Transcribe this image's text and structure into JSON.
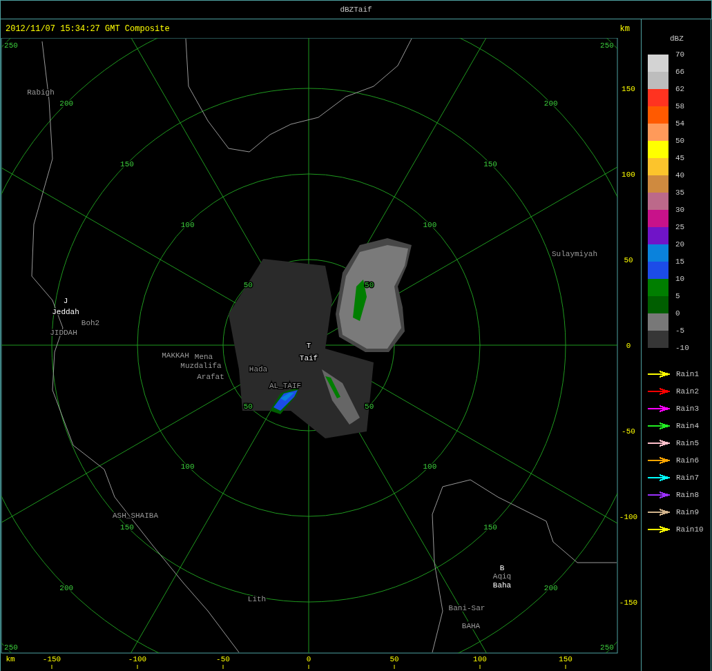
{
  "window": {
    "title": "dBZTaif"
  },
  "header": {
    "timestamp": "2012/11/07 15:34:27 GMT Composite",
    "unit": "km"
  },
  "radar_map": {
    "range_rings": [
      {
        "labels": [
          "50",
          "50",
          "50",
          "50"
        ]
      },
      {
        "labels": [
          "100",
          "100",
          "100",
          "100"
        ]
      },
      {
        "labels": [
          "150",
          "150",
          "150",
          "150"
        ]
      },
      {
        "labels": [
          "200",
          "200",
          "200",
          "200"
        ]
      },
      {
        "labels": [
          "250",
          "250",
          "250",
          "250"
        ]
      }
    ],
    "places": [
      {
        "name": "Rabigh",
        "kind": "place"
      },
      {
        "name": "J",
        "kind": "station"
      },
      {
        "name": "Jeddah",
        "kind": "station"
      },
      {
        "name": "Boh2",
        "kind": "place"
      },
      {
        "name": "JIDDAH",
        "kind": "place"
      },
      {
        "name": "MAKKAH",
        "kind": "place"
      },
      {
        "name": "Mena",
        "kind": "place"
      },
      {
        "name": "Muzdalifa",
        "kind": "place"
      },
      {
        "name": "Arafat",
        "kind": "place"
      },
      {
        "name": "Hada",
        "kind": "place"
      },
      {
        "name": "AL_TAIF",
        "kind": "place"
      },
      {
        "name": "T",
        "kind": "station"
      },
      {
        "name": "Taif",
        "kind": "station"
      },
      {
        "name": "Sulaymiyah",
        "kind": "place"
      },
      {
        "name": "ASH_SHAIBA",
        "kind": "place"
      },
      {
        "name": "Lith",
        "kind": "place"
      },
      {
        "name": "B",
        "kind": "station"
      },
      {
        "name": "Aqiq",
        "kind": "place"
      },
      {
        "name": "Baha",
        "kind": "station"
      },
      {
        "name": "Bani-Sar",
        "kind": "place"
      },
      {
        "name": "BAHA",
        "kind": "place"
      }
    ],
    "x_axis": {
      "unit": "km",
      "ticks": [
        "-150",
        "-100",
        "-50",
        "0",
        "50",
        "100",
        "150"
      ]
    },
    "y_axis": {
      "ticks": [
        "150",
        "100",
        "50",
        "0",
        "-50",
        "-100",
        "-150"
      ]
    }
  },
  "legend": {
    "title": "dBZ",
    "bands": [
      {
        "color": "#d3d3d3"
      },
      {
        "color": "#bdbdbd"
      },
      {
        "color": "#ff3320"
      },
      {
        "color": "#ff5a00"
      },
      {
        "color": "#ff9a5a"
      },
      {
        "color": "#ffff00"
      },
      {
        "color": "#fcc42c"
      },
      {
        "color": "#cf8a3f"
      },
      {
        "color": "#bc698a"
      },
      {
        "color": "#c8128a"
      },
      {
        "color": "#7014c8"
      },
      {
        "color": "#0a82dc"
      },
      {
        "color": "#1c4ce8"
      },
      {
        "color": "#007e00"
      },
      {
        "color": "#005e00"
      },
      {
        "color": "#787878"
      },
      {
        "color": "#363636"
      }
    ],
    "ticks": [
      "70",
      "66",
      "62",
      "58",
      "54",
      "50",
      "45",
      "40",
      "35",
      "30",
      "25",
      "20",
      "15",
      "10",
      "5",
      "0",
      "-5",
      "-10"
    ],
    "tracks": [
      {
        "label": "Rain1",
        "color": "#ffff00"
      },
      {
        "label": "Rain2",
        "color": "#ff0000"
      },
      {
        "label": "Rain3",
        "color": "#ff00ff"
      },
      {
        "label": "Rain4",
        "color": "#22ee22"
      },
      {
        "label": "Rain5",
        "color": "#ffc0cb"
      },
      {
        "label": "Rain6",
        "color": "#ffa500"
      },
      {
        "label": "Rain7",
        "color": "#00ffff"
      },
      {
        "label": "Rain8",
        "color": "#9b30ff"
      },
      {
        "label": "Rain9",
        "color": "#d2b48c"
      },
      {
        "label": "Rain10",
        "color": "#ffff00"
      }
    ]
  }
}
